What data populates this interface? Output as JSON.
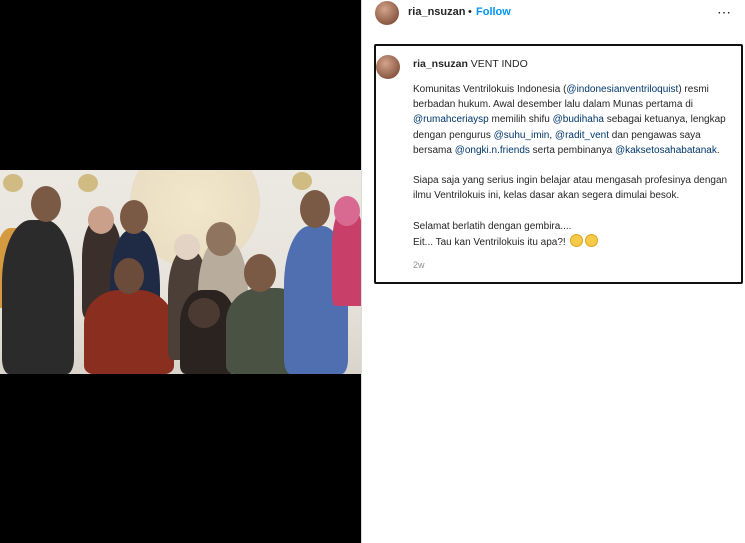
{
  "post": {
    "username": "ria_nsuzan",
    "dot": "•",
    "follow_label": "Follow",
    "more_icon": "⋯"
  },
  "caption": {
    "username": "ria_nsuzan",
    "title": "VENT INDO",
    "line1_a": "Komunitas Ventrilokuis Indonesia (",
    "mention1": "@indonesianventriloquist",
    "line1_b": ") resmi berbadan hukum. Awal desember lalu dalam Munas pertama di ",
    "mention2": "@rumahceriaysp",
    "line2_b": " memilih shifu ",
    "mention3": "@budihaha",
    "line3_b": " sebagai ketuanya, lengkap dengan pengurus ",
    "mention4": "@suhu_imin",
    "sep1": ", ",
    "mention5": "@radit_vent",
    "line4_b": " dan pengawas saya bersama ",
    "mention6": "@ongki.n.friends",
    "line5_b": " serta pembinanya ",
    "mention7": "@kaksetosahabatanak",
    "line6_b": ".",
    "para2": "Siapa saja yang serius ingin belajar atau mengasah profesinya dengan ilmu Ventrilokuis ini, kelas dasar akan segera dimulai besok.",
    "para3a": "Selamat berlatih dengan gembira....",
    "para3b": "Eit... Tau kan Ventrilokuis itu apa?! ",
    "emoji1": "grinning-face",
    "emoji2": "grinning-face",
    "timestamp": "2w"
  }
}
